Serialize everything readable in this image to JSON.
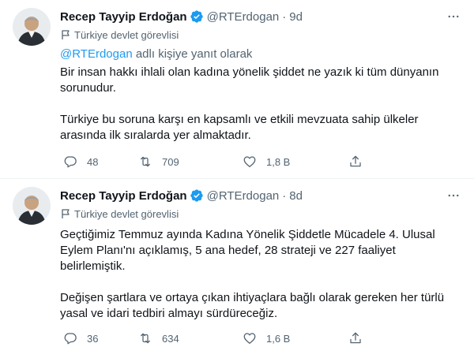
{
  "tweets": [
    {
      "author_name": "Recep Tayyip Erdoğan",
      "handle": "@RTErdogan",
      "separator": "·",
      "time": "9d",
      "label": "Türkiye devlet görevlisi",
      "reply_to_mention": "@RTErdogan",
      "reply_to_suffix": " adlı kişiye yanıt olarak",
      "paragraph_1": "Bir insan hakkı ihlali olan kadına yönelik şiddet ne yazık ki tüm dünyanın sorunudur.",
      "paragraph_2": "Türkiye bu soruna karşı en kapsamlı ve etkili mevzuata sahip ülkeler arasında ilk sıralarda yer almaktadır.",
      "replies": "48",
      "retweets": "709",
      "likes": "1,8 B"
    },
    {
      "author_name": "Recep Tayyip Erdoğan",
      "handle": "@RTErdogan",
      "separator": "·",
      "time": "8d",
      "label": "Türkiye devlet görevlisi",
      "paragraph_1": "Geçtiğimiz Temmuz ayında Kadına Yönelik Şiddetle Mücadele 4. Ulusal Eylem Planı'nı açıklamış, 5 ana hedef, 28 strateji ve 227 faaliyet belirlemiştik.",
      "paragraph_2": "Değişen şartlara ve ortaya çıkan ihtiyaçlara bağlı olarak gereken her türlü yasal ve idari tedbiri almayı sürdüreceğiz.",
      "replies": "36",
      "retweets": "634",
      "likes": "1,6 B"
    }
  ],
  "colors": {
    "accent": "#1d9bf0",
    "secondary_text": "#536471",
    "primary_text": "#0f1419",
    "divider": "#eff3f4"
  },
  "icons": [
    "verified-badge-icon",
    "more-options-icon",
    "flag-icon",
    "reply-icon",
    "retweet-icon",
    "like-icon",
    "share-icon"
  ]
}
